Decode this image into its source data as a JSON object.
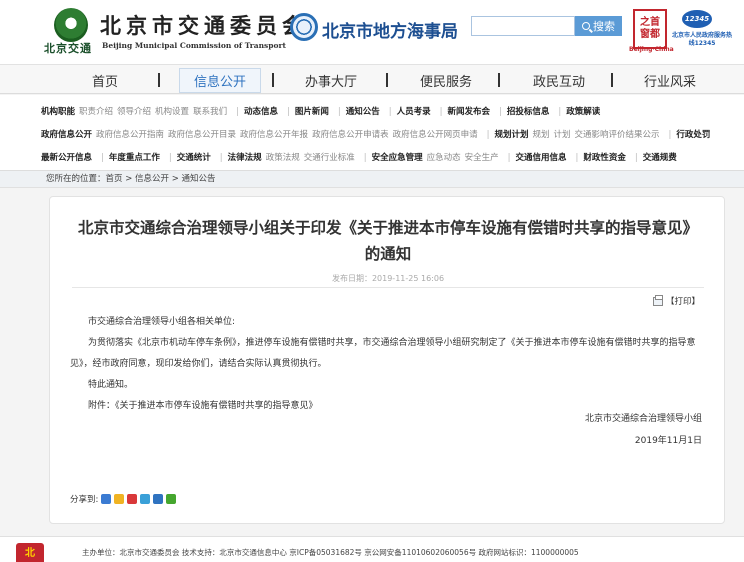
{
  "header": {
    "logo_short": "北京交通",
    "logo_title": "北京市交通委员会",
    "logo_en": "Beijing Municipal Commission of Transport",
    "maritime_title": "北京市地方海事局",
    "search_placeholder": "",
    "search_label": "搜索",
    "capital_badge_line1": "之首",
    "capital_badge_line2": "窗都",
    "capital_badge_sub": "Beijing·China",
    "hotline_number": "12345",
    "hotline_text": "北京市人民政府服务热线12345"
  },
  "main_nav": {
    "items": [
      "首页",
      "信息公开",
      "办事大厅",
      "便民服务",
      "政民互动",
      "行业风采"
    ],
    "active": "信息公开"
  },
  "sub_nav": {
    "row1": [
      {
        "label": "机构职能",
        "bold": true
      },
      {
        "label": "职责介绍",
        "bold": false
      },
      {
        "label": "领导介绍",
        "bold": false
      },
      {
        "label": "机构设置",
        "bold": false
      },
      {
        "label": "联系我们",
        "bold": false
      },
      {
        "label": "动态信息",
        "bold": true
      },
      {
        "label": "图片新闻",
        "bold": true
      },
      {
        "label": "通知公告",
        "bold": true
      },
      {
        "label": "人员考录",
        "bold": true
      },
      {
        "label": "新闻发布会",
        "bold": true
      },
      {
        "label": "招投标信息",
        "bold": true
      },
      {
        "label": "政策解读",
        "bold": true
      }
    ],
    "row2": [
      {
        "label": "政府信息公开",
        "bold": true
      },
      {
        "label": "政府信息公开指南",
        "bold": false
      },
      {
        "label": "政府信息公开目录",
        "bold": false
      },
      {
        "label": "政府信息公开年报",
        "bold": false
      },
      {
        "label": "政府信息公开申请表",
        "bold": false
      },
      {
        "label": "政府信息公开网页申请",
        "bold": false
      },
      {
        "label": "规划计划",
        "bold": true
      },
      {
        "label": "规划",
        "bold": false
      },
      {
        "label": "计划",
        "bold": false
      },
      {
        "label": "交通影响评价结果公示",
        "bold": false
      },
      {
        "label": "行政处罚",
        "bold": true
      }
    ],
    "row3": [
      {
        "label": "最新公开信息",
        "bold": true
      },
      {
        "label": "年度重点工作",
        "bold": true
      },
      {
        "label": "交通统计",
        "bold": true
      },
      {
        "label": "法律法规",
        "bold": true
      },
      {
        "label": "政策法规",
        "bold": false
      },
      {
        "label": "交通行业标准",
        "bold": false
      },
      {
        "label": "安全应急管理",
        "bold": true
      },
      {
        "label": "应急动态",
        "bold": false
      },
      {
        "label": "安全生产",
        "bold": false
      },
      {
        "label": "交通信用信息",
        "bold": true
      },
      {
        "label": "财政性资金",
        "bold": true
      },
      {
        "label": "交通规费",
        "bold": true
      }
    ]
  },
  "breadcrumb": "您所在的位置：首页 > 信息公开 > 通知公告",
  "article": {
    "title": "北京市交通综合治理领导小组关于印发《关于推进本市停车设施有偿错时共享的指导意见》的通知",
    "pubdate": "发布日期：2019-11-25 16:06",
    "print_label": "【打印】",
    "salutation": "市交通综合治理领导小组各相关单位:",
    "paragraph": "为贯彻落实《北京市机动车停车条例》，推进停车设施有偿错时共享，市交通综合治理领导小组研究制定了《关于推进本市停车设施有偿错时共享的指导意见》，经市政府同意，现印发给你们，请结合实际认真贯彻执行。",
    "notice": "特此通知。",
    "attachment": "附件：《关于推进本市停车设施有偿错时共享的指导意见》",
    "signature_org": "北京市交通综合治理领导小组",
    "signature_date": "2019年11月1日",
    "share_label": "分享到:",
    "share_icons": [
      {
        "name": "share-more-icon",
        "color": "#3b7bd2"
      },
      {
        "name": "share-qzone-icon",
        "color": "#f0b323"
      },
      {
        "name": "share-weibo-icon",
        "color": "#d9383a"
      },
      {
        "name": "share-tencent-weibo-icon",
        "color": "#3aa0d8"
      },
      {
        "name": "share-renren-icon",
        "color": "#2f73c0"
      },
      {
        "name": "share-wechat-icon",
        "color": "#45a62e"
      }
    ]
  },
  "footer": {
    "badge": "北",
    "text": "主办单位：北京市交通委员会   技术支持：北京市交通信息中心   京ICP备05031682号   京公网安备11010602060056号   政府网站标识：1100000005"
  }
}
